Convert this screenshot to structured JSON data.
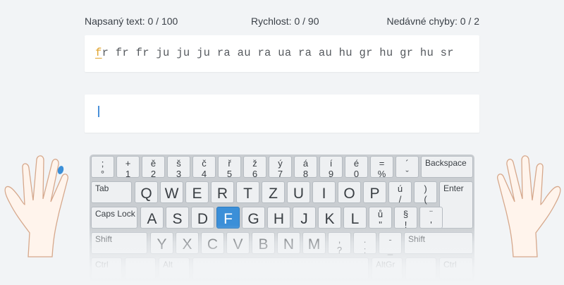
{
  "stats": {
    "typed": "Napsaný text: 0 / 100",
    "speed": "Rychlost: 0 / 90",
    "errors": "Nedávné chyby: 0 / 2"
  },
  "exercise": {
    "current_char": "f",
    "remaining_text": "r fr fr ju ju ju ra au ra ua ra au hu gr hu gr hu sr"
  },
  "colors": {
    "accent": "#3b8fd8",
    "highlight": "#e0a22a"
  },
  "keyboard": {
    "active_key": "F",
    "row1": [
      {
        "top": ";",
        "bottom": "°"
      },
      {
        "top": "+",
        "bottom": "1"
      },
      {
        "top": "ě",
        "bottom": "2"
      },
      {
        "top": "š",
        "bottom": "3"
      },
      {
        "top": "č",
        "bottom": "4"
      },
      {
        "top": "ř",
        "bottom": "5"
      },
      {
        "top": "ž",
        "bottom": "6"
      },
      {
        "top": "ý",
        "bottom": "7"
      },
      {
        "top": "á",
        "bottom": "8"
      },
      {
        "top": "í",
        "bottom": "9"
      },
      {
        "top": "é",
        "bottom": "0"
      },
      {
        "top": "=",
        "bottom": "%"
      },
      {
        "top": "´",
        "bottom": "ˇ"
      }
    ],
    "backspace": "Backspace",
    "tab": "Tab",
    "row2_letters": [
      "Q",
      "W",
      "E",
      "R",
      "T",
      "Z",
      "U",
      "I",
      "O",
      "P"
    ],
    "row2_syms": [
      {
        "top": "ú",
        "bottom": "/"
      },
      {
        "top": ")",
        "bottom": "("
      }
    ],
    "enter": "Enter",
    "caps": "Caps Lock",
    "row3_letters": [
      "A",
      "S",
      "D",
      "F",
      "G",
      "H",
      "J",
      "K",
      "L"
    ],
    "row3_syms": [
      {
        "top": "ů",
        "bottom": "\""
      },
      {
        "top": "§",
        "bottom": "!"
      },
      {
        "top": "¨",
        "bottom": "'"
      }
    ],
    "shift": "Shift",
    "row4_letters": [
      "Y",
      "X",
      "C",
      "V",
      "B",
      "N",
      "M"
    ],
    "row4_syms": [
      {
        "top": ",",
        "bottom": "?"
      },
      {
        "top": ".",
        "bottom": ":"
      },
      {
        "top": "-",
        "bottom": "_"
      }
    ],
    "ctrl": "Ctrl",
    "alt": "Alt",
    "altgr": "AltGr"
  }
}
